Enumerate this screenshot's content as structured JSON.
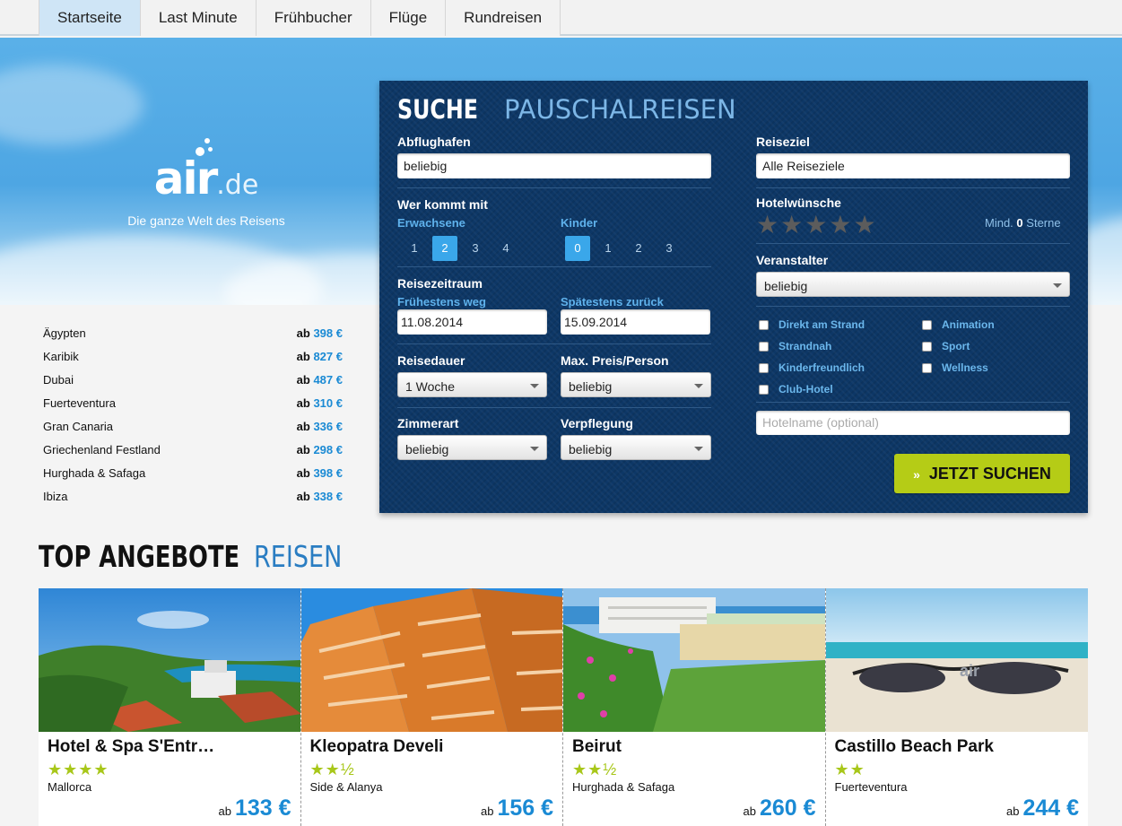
{
  "nav": {
    "tabs": [
      "Startseite",
      "Last Minute",
      "Frühbucher",
      "Flüge",
      "Rundreisen"
    ],
    "active": "Startseite"
  },
  "logo": {
    "word": "air",
    "suffix": ".de",
    "tagline": "Die ganze Welt des Reisens"
  },
  "destinations": [
    {
      "name": "Ägypten",
      "ab": "ab",
      "price": "398 €"
    },
    {
      "name": "Karibik",
      "ab": "ab",
      "price": "827 €"
    },
    {
      "name": "Dubai",
      "ab": "ab",
      "price": "487 €"
    },
    {
      "name": "Fuerteventura",
      "ab": "ab",
      "price": "310 €"
    },
    {
      "name": "Gran Canaria",
      "ab": "ab",
      "price": "336 €"
    },
    {
      "name": "Griechenland Festland",
      "ab": "ab",
      "price": "298 €"
    },
    {
      "name": "Hurghada & Safaga",
      "ab": "ab",
      "price": "398 €"
    },
    {
      "name": "Ibiza",
      "ab": "ab",
      "price": "338 €"
    }
  ],
  "search": {
    "title_bold": "SUCHE",
    "title_rest": "PAUSCHALREISEN",
    "airport_label": "Abflughafen",
    "airport_value": "beliebig",
    "who_label": "Wer kommt mit",
    "adults_label": "Erwachsene",
    "adults": [
      "1",
      "2",
      "3",
      "4"
    ],
    "children_label": "Kinder",
    "children": [
      "0",
      "1",
      "2",
      "3"
    ],
    "period_label": "Reisezeitraum",
    "earliest_label": "Frühestens weg",
    "earliest_value": "11.08.2014",
    "latest_label": "Spätestens zurück",
    "latest_value": "15.09.2014",
    "duration_label": "Reisedauer",
    "duration_value": "1 Woche",
    "maxprice_label": "Max. Preis/Person",
    "maxprice_value": "beliebig",
    "room_label": "Zimmerart",
    "room_value": "beliebig",
    "board_label": "Verpflegung",
    "board_value": "beliebig",
    "dest_label": "Reiseziel",
    "dest_value": "Alle Reiseziele",
    "hotel_label": "Hotelwünsche",
    "stars_count": 5,
    "min_prefix": "Mind.",
    "min_value": "0",
    "min_suffix": "Sterne",
    "operator_label": "Veranstalter",
    "operator_value": "beliebig",
    "checkboxes_left": [
      "Direkt am Strand",
      "Strandnah",
      "Kinderfreundlich",
      "Club-Hotel"
    ],
    "checkboxes_right": [
      "Animation",
      "Sport",
      "Wellness"
    ],
    "hotelname_placeholder": "Hotelname (optional)",
    "submit_label": "JETZT SUCHEN"
  },
  "offers": {
    "title_bold": "TOP ANGEBOTE",
    "title_rest": "REISEN",
    "items": [
      {
        "name": "Hotel & Spa S'Entr…",
        "stars": "★★★★",
        "loc": "Mallorca",
        "ab": "ab",
        "price": "133 €"
      },
      {
        "name": "Kleopatra Develi",
        "stars": "★★½",
        "loc": "Side & Alanya",
        "ab": "ab",
        "price": "156 €"
      },
      {
        "name": "Beirut",
        "stars": "★★½",
        "loc": "Hurghada & Safaga",
        "ab": "ab",
        "price": "260 €"
      },
      {
        "name": "Castillo Beach Park",
        "stars": "★★",
        "loc": "Fuerteventura",
        "ab": "ab",
        "price": "244 €"
      }
    ]
  },
  "colors": {
    "accent": "#1a8ad4",
    "panel": "#0d3766",
    "button": "#b5cc16",
    "star": "#a8c71a"
  }
}
